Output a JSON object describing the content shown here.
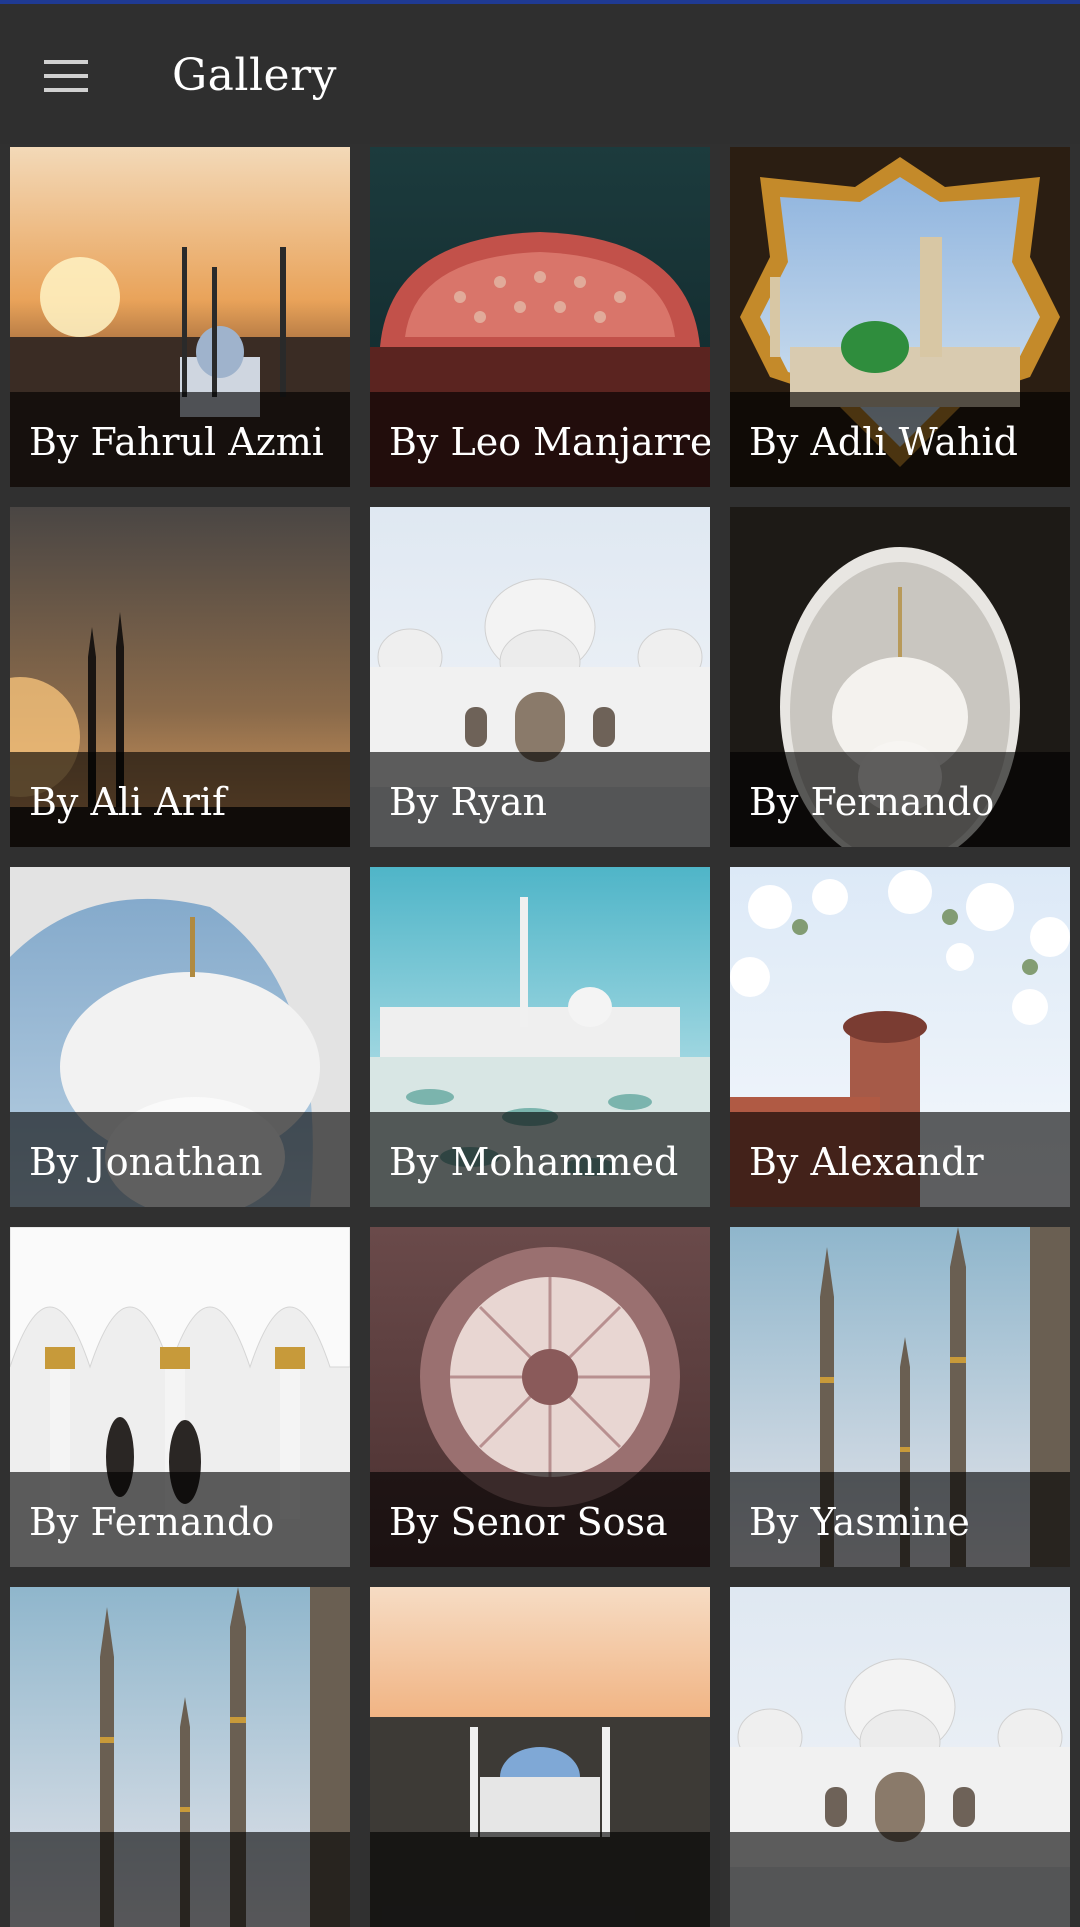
{
  "app_bar": {
    "title": "Gallery",
    "menu_icon": "hamburger-menu-icon",
    "accent_color": "#1f3a93",
    "background_color": "#2f2f2f"
  },
  "gallery": {
    "items": [
      {
        "caption": "By Fahrul Azmi",
        "scene": "sunset-mosque"
      },
      {
        "caption": "By Leo Manjarrez",
        "scene": "ornate-ceiling"
      },
      {
        "caption": "By Adli Wahid",
        "scene": "star-window-green-dome"
      },
      {
        "caption": "By Ali Arif",
        "scene": "minaret-silhouette"
      },
      {
        "caption": "By Ryan",
        "scene": "white-mosque"
      },
      {
        "caption": "By Fernando",
        "scene": "arched-window-dome"
      },
      {
        "caption": "By Jonathan",
        "scene": "dome-through-arch"
      },
      {
        "caption": "By Mohammed",
        "scene": "courtyard-turquoise-sky"
      },
      {
        "caption": "By Alexandr",
        "scene": "tower-blossoms"
      },
      {
        "caption": "By Fernando",
        "scene": "arcade-golden-columns"
      },
      {
        "caption": "By Senor Sosa",
        "scene": "blue-dome-interior"
      },
      {
        "caption": "By Yasmine",
        "scene": "minarets-blue-sky"
      },
      {
        "caption": "",
        "scene": "tall-minarets-sky"
      },
      {
        "caption": "",
        "scene": "sunset-blue-dome"
      },
      {
        "caption": "",
        "scene": "white-mosque-front"
      }
    ]
  }
}
